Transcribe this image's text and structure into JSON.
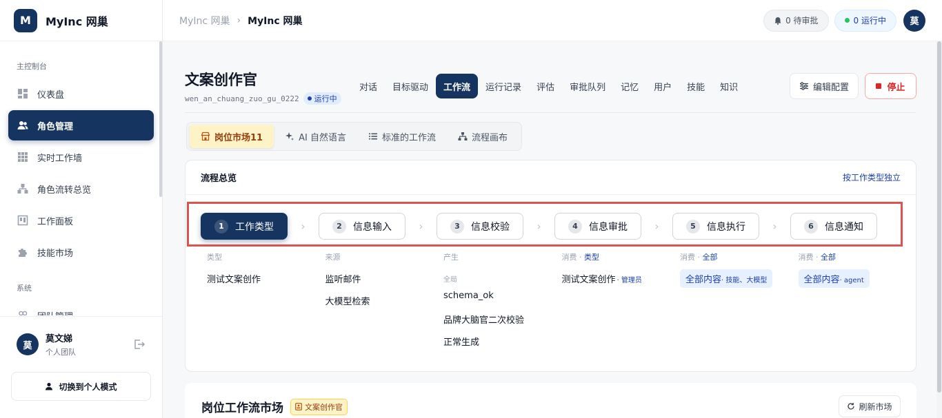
{
  "brand": {
    "logo_letter": "M",
    "name": "MyInc 网巢"
  },
  "sidebar": {
    "section_main": "主控制台",
    "items": [
      {
        "label": "仪表盘",
        "icon": "dashboard-icon"
      },
      {
        "label": "角色管理",
        "icon": "users-icon",
        "active": true
      },
      {
        "label": "实时工作墙",
        "icon": "grid-icon"
      },
      {
        "label": "角色流转总览",
        "icon": "flow-icon"
      },
      {
        "label": "工作面板",
        "icon": "panel-icon"
      },
      {
        "label": "技能市场",
        "icon": "puzzle-icon"
      }
    ],
    "section_system": "系统",
    "system_items": [
      {
        "label": "团队管理",
        "icon": "team-icon"
      }
    ]
  },
  "user": {
    "avatar": "莫",
    "name": "莫文娣",
    "team": "个人团队",
    "switch_label": "切换到个人模式"
  },
  "topbar": {
    "crumb_parent": "MyInc 网巢",
    "crumb_sep": "›",
    "crumb_current": "MyInc 网巢",
    "pending_label": "0 待审批",
    "running_label": "0 运行中",
    "avatar": "莫"
  },
  "page": {
    "title": "文案创作官",
    "agent_id": "wen_an_chuang_zuo_gu_0222",
    "status": "运行中",
    "tabs": [
      "对话",
      "目标驱动",
      "工作流",
      "运行记录",
      "评估",
      "审批队列",
      "记忆",
      "用户",
      "技能",
      "知识"
    ],
    "active_tab": "工作流",
    "config_label": "编辑配置",
    "stop_label": "停止"
  },
  "subtabs": [
    {
      "label": "岗位市场11",
      "icon": "market-icon",
      "active": true
    },
    {
      "label": "AI 自然语言",
      "icon": "sparkle-icon"
    },
    {
      "label": "标准的工作流",
      "icon": "list-icon"
    },
    {
      "label": "流程画布",
      "icon": "canvas-icon"
    }
  ],
  "overview": {
    "title": "流程总览",
    "link": "按工作类型独立",
    "steps": [
      {
        "num": "1",
        "label": "工作类型",
        "active": true
      },
      {
        "num": "2",
        "label": "信息输入"
      },
      {
        "num": "3",
        "label": "信息校验"
      },
      {
        "num": "4",
        "label": "信息审批"
      },
      {
        "num": "5",
        "label": "信息执行"
      },
      {
        "num": "6",
        "label": "信息通知"
      }
    ],
    "step_arrow": "›",
    "columns": {
      "c1": {
        "head": "类型",
        "items": [
          "测试文案创作"
        ]
      },
      "c2": {
        "head": "来源",
        "items": [
          "监听邮件",
          "大模型检索"
        ]
      },
      "c3": {
        "head": "产生",
        "sub": "全局",
        "items": [
          "schema_ok",
          "品牌大脑官二次校验",
          "正常生成"
        ]
      },
      "c4": {
        "head": "消费",
        "head_sep": "·",
        "head_extra": "类型",
        "item": "测试文案创作",
        "item_small": "· 管理员"
      },
      "c5": {
        "head": "消费",
        "head_sep": "·",
        "head_extra": "全部",
        "tag": "全部内容",
        "tag_small": "· 技能、大模型"
      },
      "c6": {
        "head": "消费",
        "head_sep": "·",
        "head_extra": "全部",
        "tag": "全部内容",
        "tag_small": "· agent"
      }
    }
  },
  "market": {
    "title": "岗位工作流市场",
    "role_chip": "文案创作官",
    "refresh_label": "刷新市场"
  },
  "colors": {
    "primary": "#15345f",
    "highlight_border": "#e05252",
    "stop": "#dc2626",
    "market_tab": "#fef3c7"
  }
}
